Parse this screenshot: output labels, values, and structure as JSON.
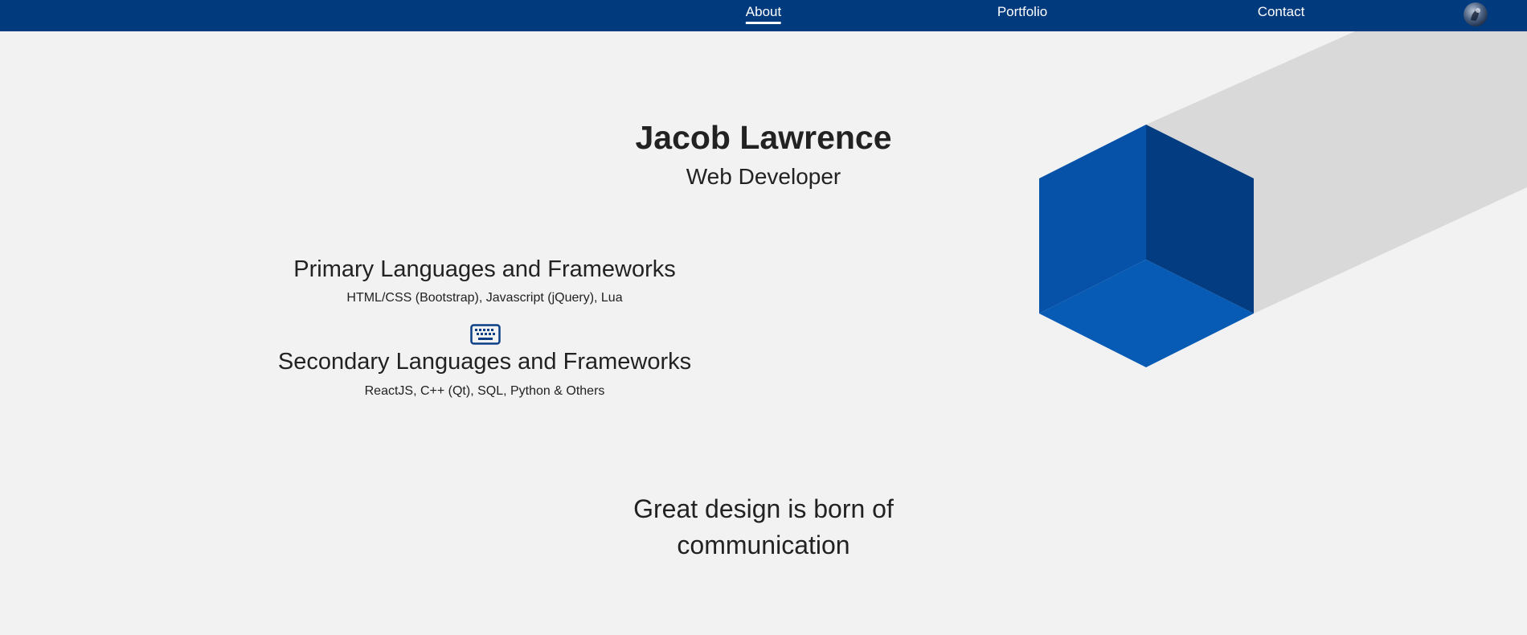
{
  "nav": {
    "links": [
      {
        "label": "About",
        "active": true
      },
      {
        "label": "Portfolio",
        "active": false
      },
      {
        "label": "Contact",
        "active": false
      }
    ],
    "avatar_icon": "profile-avatar"
  },
  "hero": {
    "name": "Jacob Lawrence",
    "role": "Web Developer"
  },
  "skills": {
    "primary": {
      "heading": "Primary Languages and Frameworks",
      "list": "HTML/CSS (Bootstrap), Javascript (jQuery), Lua"
    },
    "icon": "keyboard-icon",
    "secondary": {
      "heading": "Secondary Languages and Frameworks",
      "list": "ReactJS, C++ (Qt), SQL, Python & Others"
    }
  },
  "quote": {
    "text": "Great design is born of communication"
  },
  "colors": {
    "nav_bg": "#023a7e",
    "page_bg": "#f2f2f2",
    "cube_left": "#0552a8",
    "cube_right": "#033c80",
    "cube_bottom": "#075bb5",
    "shadow": "#d9d9d9",
    "text": "#222222"
  }
}
